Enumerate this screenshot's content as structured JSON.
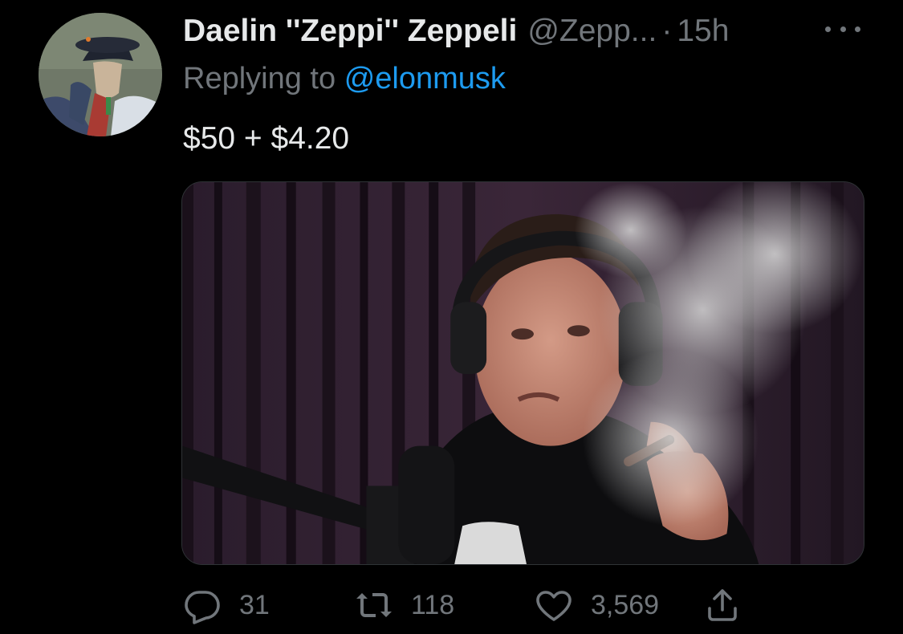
{
  "tweet": {
    "author": {
      "display_name": "Daelin ''Zeppi'' Zeppeli",
      "handle": "@Zepp...",
      "avatar_icon": "avatar-image"
    },
    "separator": "·",
    "timestamp": "15h",
    "more_icon": "more-horizontal-icon",
    "replying_to_prefix": "Replying to",
    "replying_to_handle": "@elonmusk",
    "text": "$50 + $4.20",
    "media_icon": "photo-podcast-smoking-man"
  },
  "actions": {
    "reply": {
      "count": "31",
      "icon": "reply-icon"
    },
    "retweet": {
      "count": "118",
      "icon": "retweet-icon"
    },
    "like": {
      "count": "3,569",
      "icon": "heart-icon"
    },
    "share": {
      "icon": "share-icon"
    }
  },
  "colors": {
    "background": "#000000",
    "primary_text": "#e7e9ea",
    "secondary_text": "#71767b",
    "link": "#1d9bf0"
  }
}
